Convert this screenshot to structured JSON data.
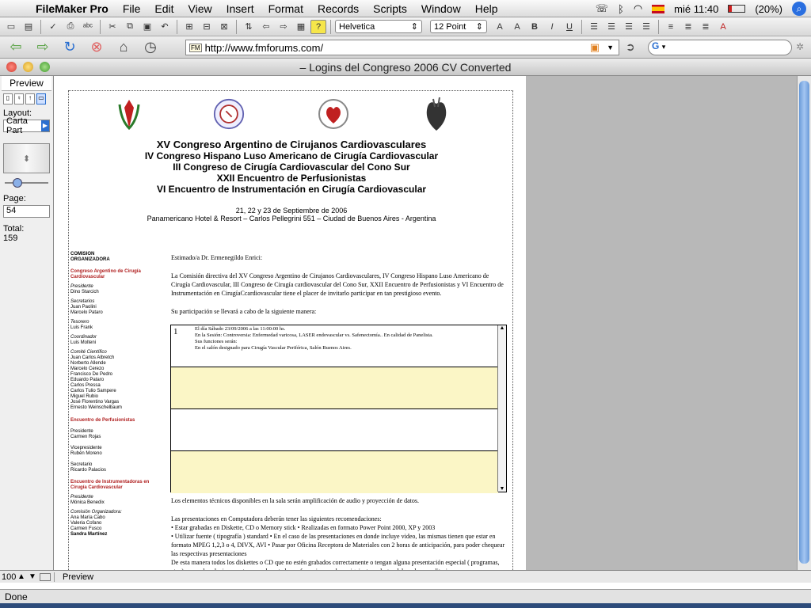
{
  "menubar": {
    "app_name": "FileMaker Pro",
    "items": [
      "File",
      "Edit",
      "View",
      "Insert",
      "Format",
      "Records",
      "Scripts",
      "Window",
      "Help"
    ],
    "clock": "mié 11:40",
    "battery": "(20%)"
  },
  "formatbar": {
    "font": "Helvetica",
    "size": "12 Point"
  },
  "browser": {
    "url": "http://www.fmforums.com/",
    "status": "Done"
  },
  "window": {
    "title": "–  Logins del Congreso 2006 CV Converted"
  },
  "statusarea": {
    "mode": "Preview",
    "layout_label": "Layout:",
    "layout_value": "Carta Part",
    "page_label": "Page:",
    "page_value": "54",
    "total_label": "Total:",
    "total_value": "159"
  },
  "document": {
    "headings": [
      "XV Congreso Argentino de Cirujanos Cardiovasculares",
      "IV Congreso Hispano Luso Americano de Cirugía Cardiovascular",
      "III Congreso de Cirugía Cardiovascular del Cono Sur",
      "XXII Encuentro de Perfusionistas",
      "VI Encuentro de Instrumentación en Cirugía Cardiovascular"
    ],
    "dates": "21, 22 y 23 de Septiembre de 2006",
    "venue": "Panamericano Hotel & Resort – Carlos Pellegrini 551 – Ciudad de Buenos Aires - Argentina",
    "committee": {
      "title1": "COMISION",
      "title2": "ORGANIZADORA",
      "section1": "Congreso Argentino de Cirugía Cardiovascular",
      "presidente_label": "Presidente",
      "presidente": "Dino Starcich",
      "secretarios_label": "Secretarios",
      "secretarios": [
        "Juan Paolini",
        "Marcelo Pataro"
      ],
      "tesorero_label": "Tesorero",
      "tesorero": "Luis Frank",
      "coordinador_label": "Coordinador",
      "coordinador": "Luis Molteni",
      "comite_label": "Comité Científico",
      "comite": [
        "Juan Carlos Albretch",
        "Norberto Allende",
        "Marcelo Cerezo",
        "Francisco De Pedro",
        "Eduardo Pataro",
        "Carlos Pressa",
        "Carlos Tulio Sampere",
        "Miguel Rubio",
        "José Florentino Vargas",
        "Ernesto Weinschelbaum"
      ],
      "section2": "Encuentro de Perfusionistas",
      "perf_pres_label": "Presidente",
      "perf_pres": "Carmen Rojas",
      "perf_vice_label": "Vicepresidente",
      "perf_vice": "Rubén Moreno",
      "perf_sec_label": "Secretario",
      "perf_sec": "Ricardo Palacios",
      "section3": "Encuentro de Instrumentadoras en Cirugía Cardiovascular",
      "inst_pres_label": "Presidente",
      "inst_pres": "Mónica Benedix",
      "inst_com_label": "Comisión Organizadora:",
      "inst_com": [
        "Ana María Cabo",
        "Valeria Cofano",
        "Carmen Fusco",
        "Sandra Martínez"
      ]
    },
    "greeting": "Estimado/a Dr. Ermenegildo Enrici:",
    "intro": "La Comisión directiva del XV Congreso Argentino de Cirujanos Cardiovasculares, IV Congreso Hispano Luso Americano de Cirugía Cardiovascular, III Congreso de Cirugía cardiovascular del Cono Sur, XXII Encuentro de Perfusionistas y VI Encuentro de Instrumentación en CirugíaCcardiovascular tiene el placer de invitarlo participar en tan prestigioso evento.",
    "participation": "Su participación se llevará a cabo de la siguiente manera:",
    "slot1": {
      "num": "1",
      "line1": "El día Sábado 23/09/2006 a las 11:00:00 hs.",
      "line2": "En la Sesión:  Controversia: Enfermedad varicosa, LASER endovascular vs. Safenectomía.. En calidad de Panelista.",
      "line3": "Sus funciones serán:",
      "line4": "En el salón designado para Cirugía Vascular Periférica, Salón Buenos Aires."
    },
    "tech": "Los elementos técnicos disponibles en la sala serán amplificación de audio y proyección de datos.",
    "presentations_title": "Las presentaciones en Computadora deberán tener las siguientes recomendaciones:",
    "bullet1": "• Estar grabadas en Diskette, CD o Memory stick • Realizadas en formato Power Point 2000, XP y 2003",
    "bullet2": "• Utilizar fuente ( tipografía ) standard • En el caso de las presentaciones en donde incluye video, las mismas tienen que estar en formato MPEG 1,2,3 o 4, DIVX, AVI • Pasar por Oficina Receptora de Materiales con 2 horas de anticipación,  para poder chequear las respectivas presentaciones",
    "bullet3": "De esta manera todos los diskettes o CD  que no estén grabados correctamente o tengan alguna presentación especial ( programas, etc. ) se pueda solucionar antes y no durante la conferencia con el consiguiente malestar del orador y auditorio."
  },
  "bottom": {
    "zoom": "100",
    "mode": "Preview"
  },
  "colors": {
    "accent_red": "#b02020",
    "slot_yellow": "#fbf6c6",
    "scroll_blue": "#6a9ad8"
  }
}
